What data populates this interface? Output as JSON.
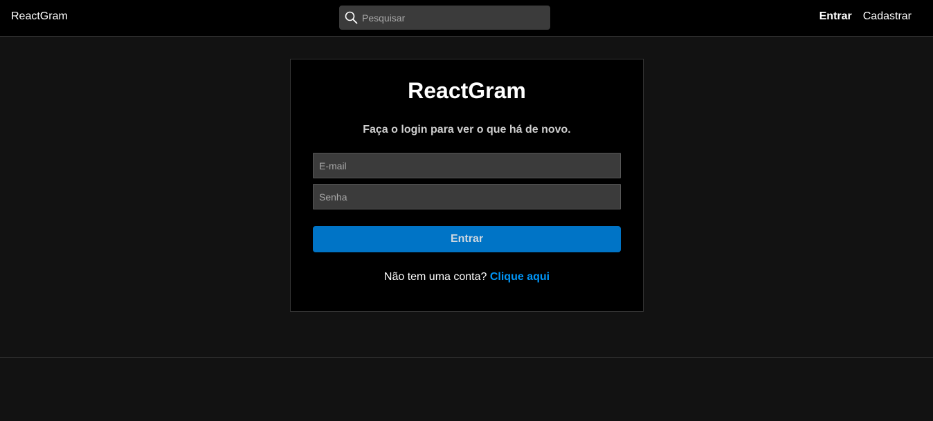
{
  "navbar": {
    "brand": "ReactGram",
    "search_placeholder": "Pesquisar",
    "search_icon": "search-icon",
    "links": [
      {
        "label": "Entrar",
        "active": true
      },
      {
        "label": "Cadastrar",
        "active": false
      }
    ]
  },
  "login": {
    "title": "ReactGram",
    "subtitle": "Faça o login para ver o que há de novo.",
    "email_placeholder": "E-mail",
    "password_placeholder": "Senha",
    "submit_label": "Entrar",
    "signup_prompt": "Não tem uma conta?",
    "signup_link": "Clique aqui"
  },
  "colors": {
    "background": "#121212",
    "navbar": "#000000",
    "card": "#000000",
    "input": "#3b3b3b",
    "primary_button": "#0074c6",
    "link": "#0095f6",
    "border": "#363636"
  }
}
